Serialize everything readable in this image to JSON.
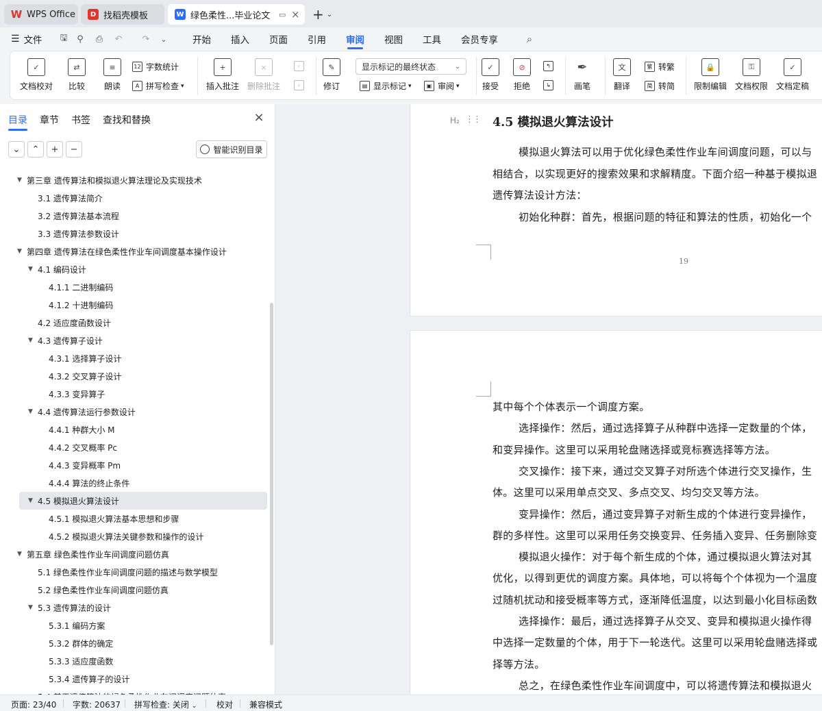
{
  "tabs": [
    {
      "label": "WPS Office",
      "icon": "wps-logo-icon"
    },
    {
      "label": "找稻壳模板",
      "icon": "docer-icon"
    },
    {
      "label": "绿色柔性...毕业论文",
      "icon": "writer-doc-icon"
    }
  ],
  "menu": {
    "file": "文件",
    "items": [
      "开始",
      "插入",
      "页面",
      "引用",
      "审阅",
      "视图",
      "工具",
      "会员专享"
    ],
    "active": "审阅"
  },
  "ribbon": {
    "doc_proofread": "文档校对",
    "compare": "比较",
    "read_aloud": "朗读",
    "word_count": "字数统计",
    "spell_check": "拼写检查",
    "insert_comment": "插入批注",
    "delete_comment": "删除批注",
    "track_changes": "修订",
    "markup_select": "显示标记的最终状态",
    "show_markup": "显示标记",
    "review": "审阅",
    "accept": "接受",
    "reject": "拒绝",
    "pen": "画笔",
    "translate": "翻译",
    "to_traditional": "转繁",
    "to_simplified": "转简",
    "restrict_edit": "限制编辑",
    "doc_permission": "文档权限",
    "doc_finalize": "文档定稿"
  },
  "nav": {
    "tabs": [
      "目录",
      "章节",
      "书签",
      "查找和替换"
    ],
    "smart_toc": "智能识别目录",
    "toc": [
      {
        "text": "第三章 遗传算法和模拟退火算法理论及实现技术",
        "level": 1,
        "caret": true
      },
      {
        "text": "3.1 遗传算法简介",
        "level": 2
      },
      {
        "text": "3.2 遗传算法基本流程",
        "level": 2
      },
      {
        "text": "3.3 遗传算法参数设计",
        "level": 2
      },
      {
        "text": "第四章 遗传算法在绿色柔性作业车间调度基本操作设计",
        "level": 1,
        "caret": true
      },
      {
        "text": "4.1 编码设计",
        "level": 2,
        "caret": true
      },
      {
        "text": "4.1.1 二进制编码",
        "level": 3
      },
      {
        "text": "4.1.2 十进制编码",
        "level": 3
      },
      {
        "text": "4.2 适应度函数设计",
        "level": 2
      },
      {
        "text": "4.3 遗传算子设计",
        "level": 2,
        "caret": true
      },
      {
        "text": "4.3.1 选择算子设计",
        "level": 3
      },
      {
        "text": "4.3.2 交叉算子设计",
        "level": 3
      },
      {
        "text": "4.3.3 变异算子",
        "level": 3
      },
      {
        "text": "4.4 遗传算法运行参数设计",
        "level": 2,
        "caret": true
      },
      {
        "text": "4.4.1 种群大小 M",
        "level": 3
      },
      {
        "text": "4.4.2 交叉概率 Pc",
        "level": 3
      },
      {
        "text": "4.4.3 变异概率 Pm",
        "level": 3
      },
      {
        "text": "4.4.4 算法的终止条件",
        "level": 3
      },
      {
        "text": "4.5 模拟退火算法设计",
        "level": 2,
        "caret": true,
        "selected": true
      },
      {
        "text": "4.5.1 模拟退火算法基本思想和步骤",
        "level": 3
      },
      {
        "text": "4.5.2 模拟退火算法关键参数和操作的设计",
        "level": 3
      },
      {
        "text": "第五章 绿色柔性作业车间调度问题仿真",
        "level": 1,
        "caret": true
      },
      {
        "text": "5.1 绿色柔性作业车间调度问题的描述与数学模型",
        "level": 2
      },
      {
        "text": "5.2 绿色柔性作业车间调度问题仿真",
        "level": 2
      },
      {
        "text": "5.3 遗传算法的设计",
        "level": 2,
        "caret": true
      },
      {
        "text": "5.3.1 编码方案",
        "level": 3
      },
      {
        "text": "5.3.2 群体的确定",
        "level": 3
      },
      {
        "text": "5.3.3 适应度函数",
        "level": 3
      },
      {
        "text": "5.3.4 遗传算子的设计",
        "level": 3
      },
      {
        "text": "5.4 基于遗传算法的绿色柔性作业车间调度问题仿真",
        "level": 2
      }
    ]
  },
  "document": {
    "heading_marker": "H₂",
    "heading": "4.5 模拟退火算法设计",
    "page1_lines": [
      "模拟退火算法可以用于优化绿色柔性作业车间调度问题，可以与",
      "相结合，以实现更好的搜索效果和求解精度。下面介绍一种基于模拟退",
      "遗传算法设计方法：",
      "初始化种群：首先，根据问题的特征和算法的性质，初始化一个"
    ],
    "page_number": "19",
    "page2_lines": [
      "其中每个个体表示一个调度方案。",
      "选择操作：然后，通过选择算子从种群中选择一定数量的个体，",
      "和变异操作。这里可以采用轮盘赌选择或竞标赛选择等方法。",
      "交叉操作：接下来，通过交叉算子对所选个体进行交叉操作，生",
      "体。这里可以采用单点交叉、多点交叉、均匀交叉等方法。",
      "变异操作：然后，通过变异算子对新生成的个体进行变异操作，",
      "群的多样性。这里可以采用任务交换变异、任务插入变异、任务删除变",
      "模拟退火操作：对于每个新生成的个体，通过模拟退火算法对其",
      "优化，以得到更优的调度方案。具体地，可以将每个个体视为一个温度",
      "过随机扰动和接受概率等方式，逐渐降低温度，以达到最小化目标函数",
      "选择操作：最后，通过选择算子从交叉、变异和模拟退火操作得",
      "中选择一定数量的个体，用于下一轮迭代。这里可以采用轮盘赌选择或",
      "择等方法。",
      "总之，在绿色柔性作业车间调度中，可以将遗传算法和模拟退火"
    ]
  },
  "status": {
    "page": "页面: 23/40",
    "words": "字数: 20637",
    "spell": "拼写检查: 关闭",
    "proof": "校对",
    "compat": "兼容模式"
  },
  "colors": {
    "accent": "#2f6bf5",
    "wps_red": "#e0342f"
  }
}
